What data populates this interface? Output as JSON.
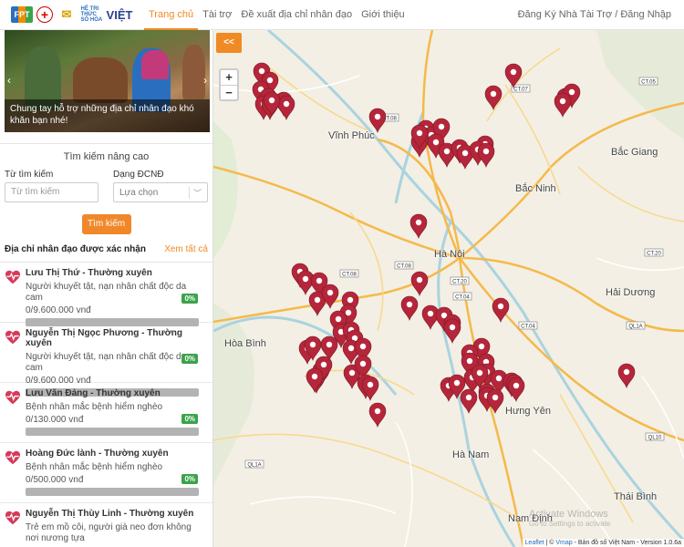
{
  "header": {
    "logos": [
      {
        "name": "fpt-logo",
        "text": "FPT"
      },
      {
        "name": "red-cross-logo",
        "text": "+"
      },
      {
        "name": "vietnam-post-logo",
        "text": "✉"
      },
      {
        "name": "he-tri-thuc-viet-logo",
        "small": "HỆ TRI THỨC SỐ HÓA",
        "big": "VIỆT"
      }
    ],
    "nav": [
      "Trang chủ",
      "Tài trợ",
      "Đề xuất địa chỉ nhân đạo",
      "Giới thiệu"
    ],
    "active_nav": 0,
    "auth": "Đăng Ký Nhà Tài Trợ / Đăng Nhập"
  },
  "slider": {
    "caption": "Chung tay hỗ trợ những địa chỉ nhân đạo khó khăn bạn nhé!",
    "prev_icon": "‹",
    "next_icon": "›"
  },
  "search": {
    "title": "Tìm kiếm nâng cao",
    "keyword_label": "Từ tìm kiếm",
    "keyword_placeholder": "Từ tìm kiếm",
    "type_label": "Dạng ĐCNĐ",
    "type_value": "Lựa chọn",
    "button": "Tìm kiếm"
  },
  "list": {
    "title": "Địa chỉ nhân đạo được xác nhận",
    "view_all": "Xem tất cả",
    "items": [
      {
        "name": "Lưu Thị Thứ - Thường xuyên",
        "desc": "Người khuyết tật, nạn nhân chất độc da cam",
        "amount": "0/9.600.000 vnđ",
        "pct": "0%",
        "progress": 0
      },
      {
        "name": "Nguyễn Thị Ngọc Phương - Thường xuyên",
        "desc": "Người khuyết tật, nạn nhân chất độc da cam",
        "amount": "0/9.600.000 vnđ",
        "pct": "0%",
        "progress": 0
      },
      {
        "name": "Lưu Văn Đảng - Thường xuyên",
        "desc": "Bệnh nhân mắc bệnh hiểm nghèo",
        "amount": "0/130.000 vnđ",
        "pct": "0%",
        "progress": 0
      },
      {
        "name": "Hoàng Đức lành - Thường xuyên",
        "desc": "Bệnh nhân mắc bệnh hiểm nghèo",
        "amount": "0/500.000 vnđ",
        "pct": "0%",
        "progress": 0
      },
      {
        "name": "Nguyễn Thị Thùy Linh - Thường xuyên",
        "desc": "Trẻ em mồ côi, người già neo đơn không nơi nương tựa",
        "amount": "",
        "pct": "",
        "progress": 0
      }
    ]
  },
  "map": {
    "collapse_label": "<<",
    "zoom_in": "+",
    "zoom_out": "−",
    "cities": [
      "Vĩnh Phúc",
      "Bắc Giang",
      "Bắc Ninh",
      "Hà Nội",
      "Hải Dương",
      "Hòa Bình",
      "Hưng Yên",
      "Hà Nam",
      "Thái Bình",
      "Nam Định"
    ],
    "road_labels": [
      "CT.07",
      "CT.05",
      "CT.08",
      "CT.08",
      "CT.08",
      "CT.20",
      "CT.04",
      "CT.04",
      "QL1A",
      "QL10",
      "QL1A",
      "CT.20"
    ],
    "marker_color": "#b5263a",
    "attribution_link": "Leaflet",
    "attribution_sep": " | © ",
    "attribution_vmap": "Vmap",
    "attribution_rest": " - Bản đồ số Việt Nam - Version 1.0.6a",
    "watermark_line1": "Activate Windows",
    "watermark_line2": "Go to Settings to activate"
  }
}
